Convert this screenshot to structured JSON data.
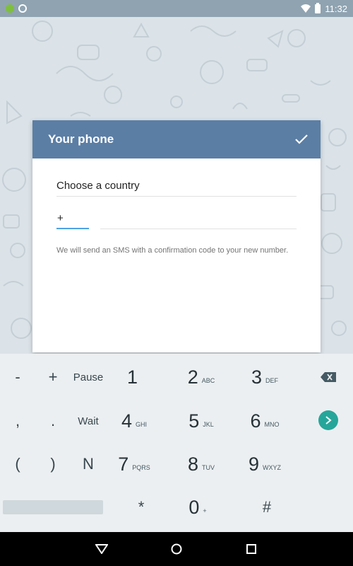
{
  "status_bar": {
    "time": "11:32"
  },
  "dialog": {
    "title": "Your phone",
    "country_label": "Choose a country",
    "country_code_value": "+",
    "phone_value": "",
    "info": "We will send an SMS with a confirmation code to your new number."
  },
  "keyboard": {
    "row1": [
      {
        "label": "-"
      },
      {
        "label": "+"
      },
      {
        "label": "Pause"
      },
      {
        "digit": "1",
        "letters": ""
      },
      {
        "digit": "2",
        "letters": "ABC"
      },
      {
        "digit": "3",
        "letters": "DEF"
      }
    ],
    "row2": [
      {
        "label": ","
      },
      {
        "label": "."
      },
      {
        "label": "Wait"
      },
      {
        "digit": "4",
        "letters": "GHI"
      },
      {
        "digit": "5",
        "letters": "JKL"
      },
      {
        "digit": "6",
        "letters": "MNO"
      }
    ],
    "row3": [
      {
        "label": "("
      },
      {
        "label": ")"
      },
      {
        "label": "N"
      },
      {
        "digit": "7",
        "letters": "PQRS"
      },
      {
        "digit": "8",
        "letters": "TUV"
      },
      {
        "digit": "9",
        "letters": "WXYZ"
      }
    ],
    "row4": [
      {
        "label": "*"
      },
      {
        "digit": "0",
        "letters": "+"
      },
      {
        "label": "#"
      }
    ]
  },
  "colors": {
    "header": "#5b7ea5",
    "accent": "#4fa2e2",
    "go": "#26a69a"
  }
}
